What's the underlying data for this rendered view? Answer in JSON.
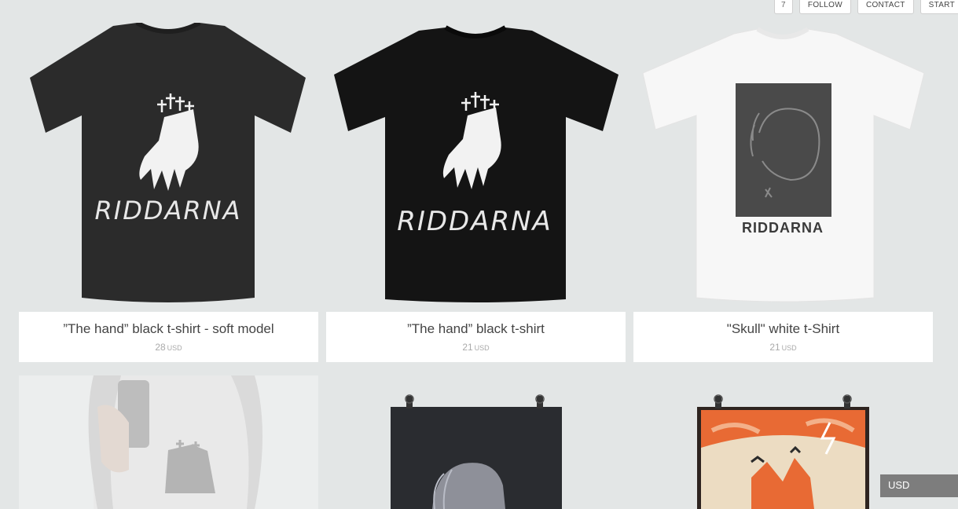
{
  "nav": {
    "cart_count": "7",
    "follow": "FOLLOW",
    "contact": "CONTACT",
    "start": "START"
  },
  "products": [
    {
      "title": "”The hand” black t-shirt - soft model",
      "price": "28",
      "currency": "USD",
      "print": "RIDDARNA"
    },
    {
      "title": "”The hand” black t-shirt",
      "price": "21",
      "currency": "USD",
      "print": "RIDDARNA"
    },
    {
      "title": "\"Skull\" white t-Shirt",
      "price": "21",
      "currency": "USD",
      "print": "RIDDARNA"
    }
  ],
  "currency_selector": {
    "value": "USD"
  },
  "colors": {
    "background": "#e3e6e6",
    "card": "#ffffff",
    "heather_black": "#2b2b2b",
    "black": "#141414"
  }
}
